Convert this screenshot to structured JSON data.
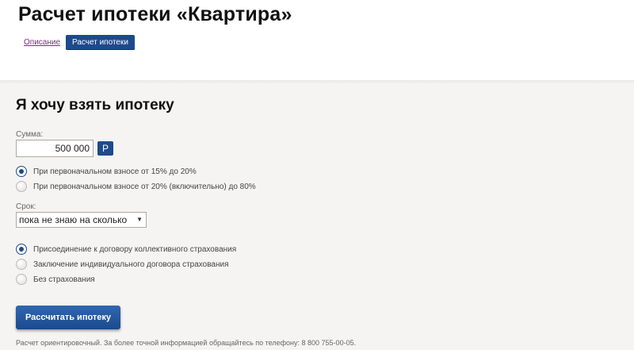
{
  "header": {
    "title": "Расчет ипотеки «Квартира»",
    "tabs": [
      {
        "label": "Описание"
      },
      {
        "label": "Расчет ипотеки"
      }
    ]
  },
  "form": {
    "section_title": "Я хочу взять ипотеку",
    "sum_label": "Сумма:",
    "sum_value": "500 000",
    "currency_button": "Р",
    "down_payment_options": [
      {
        "label": "При первоначальном взносе от 15% до 20%",
        "checked": true
      },
      {
        "label": "При первоначальном взносе от 20% (включительно) до 80%",
        "checked": false
      }
    ],
    "term_label": "Срок:",
    "term_value": "пока не знаю на сколько",
    "insurance_options": [
      {
        "label": "Присоединение к договору коллективного страхования",
        "checked": true
      },
      {
        "label": "Заключение индивидуального договора страхования",
        "checked": false
      },
      {
        "label": "Без страхования",
        "checked": false
      }
    ],
    "submit_label": "Рассчитать ипотеку",
    "note": "Расчет ориентировочный. За более точной информацией обращайтесь по телефону: 8 800 755-00-05."
  },
  "colors": {
    "accent": "#1d4a8c",
    "background": "#f6f4f2",
    "link": "#7b2b87"
  },
  "icons": {
    "select_arrow": "chevron-down-icon"
  }
}
